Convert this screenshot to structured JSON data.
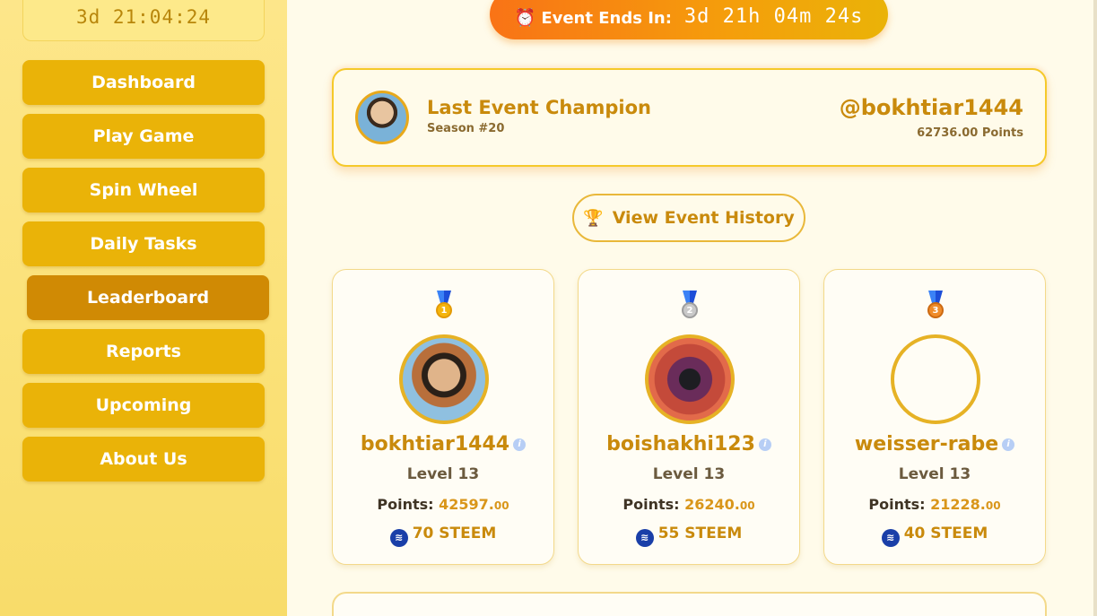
{
  "sidebar": {
    "timer": "3d 21:04:24",
    "items": [
      {
        "label": "Dashboard"
      },
      {
        "label": "Play Game"
      },
      {
        "label": "Spin Wheel"
      },
      {
        "label": "Daily Tasks"
      },
      {
        "label": "Leaderboard",
        "active": true
      },
      {
        "label": "Reports"
      },
      {
        "label": "Upcoming"
      },
      {
        "label": "About Us"
      }
    ]
  },
  "event": {
    "icon": "alarm-clock-icon",
    "label": "Event Ends In:",
    "time": "3d 21h 04m 24s"
  },
  "champion": {
    "title": "Last Event Champion",
    "season": "Season #20",
    "username": "@bokhtiar1444",
    "points": "62736.00 Points"
  },
  "history_button": {
    "icon": "trophy-icon",
    "label": "View Event History"
  },
  "leaderboard": [
    {
      "medal": "gold",
      "rank": "1",
      "name": "bokhtiar1444",
      "level": "Level 13",
      "points_label": "Points:",
      "points": "42597.",
      "points_dec": "00",
      "reward": "70 STEEM"
    },
    {
      "medal": "silver",
      "rank": "2",
      "name": "boishakhi123",
      "level": "Level 13",
      "points_label": "Points:",
      "points": "26240.",
      "points_dec": "00",
      "reward": "55 STEEM"
    },
    {
      "medal": "bronze",
      "rank": "3",
      "name": "weisser-rabe",
      "level": "Level 13",
      "points_label": "Points:",
      "points": "21228.",
      "points_dec": "00",
      "reward": "40 STEEM"
    }
  ],
  "colors": {
    "accent": "#eab308",
    "active": "#d08a04",
    "text_gold": "#c98a0c",
    "steem": "#1a3fa8"
  }
}
